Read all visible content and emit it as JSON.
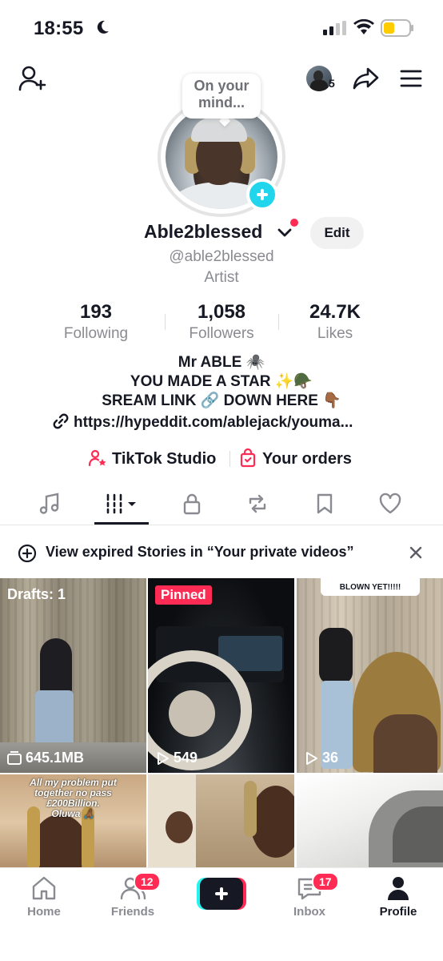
{
  "status_bar": {
    "time": "18:55"
  },
  "header": {
    "viewer_count": "5",
    "bubble_line1": "On your",
    "bubble_line2": "mind...",
    "accent": "#fe2c55",
    "plus_color": "#20d5ec"
  },
  "profile": {
    "name": "Able2blessed",
    "handle": "@able2blessed",
    "category": "Artist",
    "edit_label": "Edit"
  },
  "stats": [
    {
      "value": "193",
      "label": "Following"
    },
    {
      "value": "1,058",
      "label": "Followers"
    },
    {
      "value": "24.7K",
      "label": "Likes"
    }
  ],
  "bio": {
    "line1": "Mr ABLE 🕷️",
    "line2": "YOU MADE A STAR ✨🪖",
    "line3": "SREAM LINK 🔗 DOWN HERE 👇🏾",
    "link": "https://hypeddit.com/ablejack/youma..."
  },
  "actions": {
    "studio": "TikTok Studio",
    "orders": "Your orders"
  },
  "tabs": [
    {
      "icon": "music-note-icon"
    },
    {
      "icon": "grid-videos-icon"
    },
    {
      "icon": "lock-icon"
    },
    {
      "icon": "repost-icon"
    },
    {
      "icon": "bookmark-icon"
    },
    {
      "icon": "heart-icon"
    }
  ],
  "banner": {
    "text": "View expired Stories in “Your private videos”"
  },
  "grid": {
    "drafts_label": "Drafts: 1",
    "drafts_size": "645.1MB",
    "pinned_label": "Pinned",
    "video2_views": "549",
    "video3_views": "36",
    "video3_caption": "BLOWN YET!!!!!",
    "video4_line1": "All my problem put",
    "video4_line2": "together no pass",
    "video4_line3": "£200Billion.",
    "video4_line4": "Oluwa 🙏🏾"
  },
  "nav": {
    "home": "Home",
    "friends": "Friends",
    "friends_badge": "12",
    "inbox": "Inbox",
    "inbox_badge": "17",
    "profile": "Profile"
  }
}
